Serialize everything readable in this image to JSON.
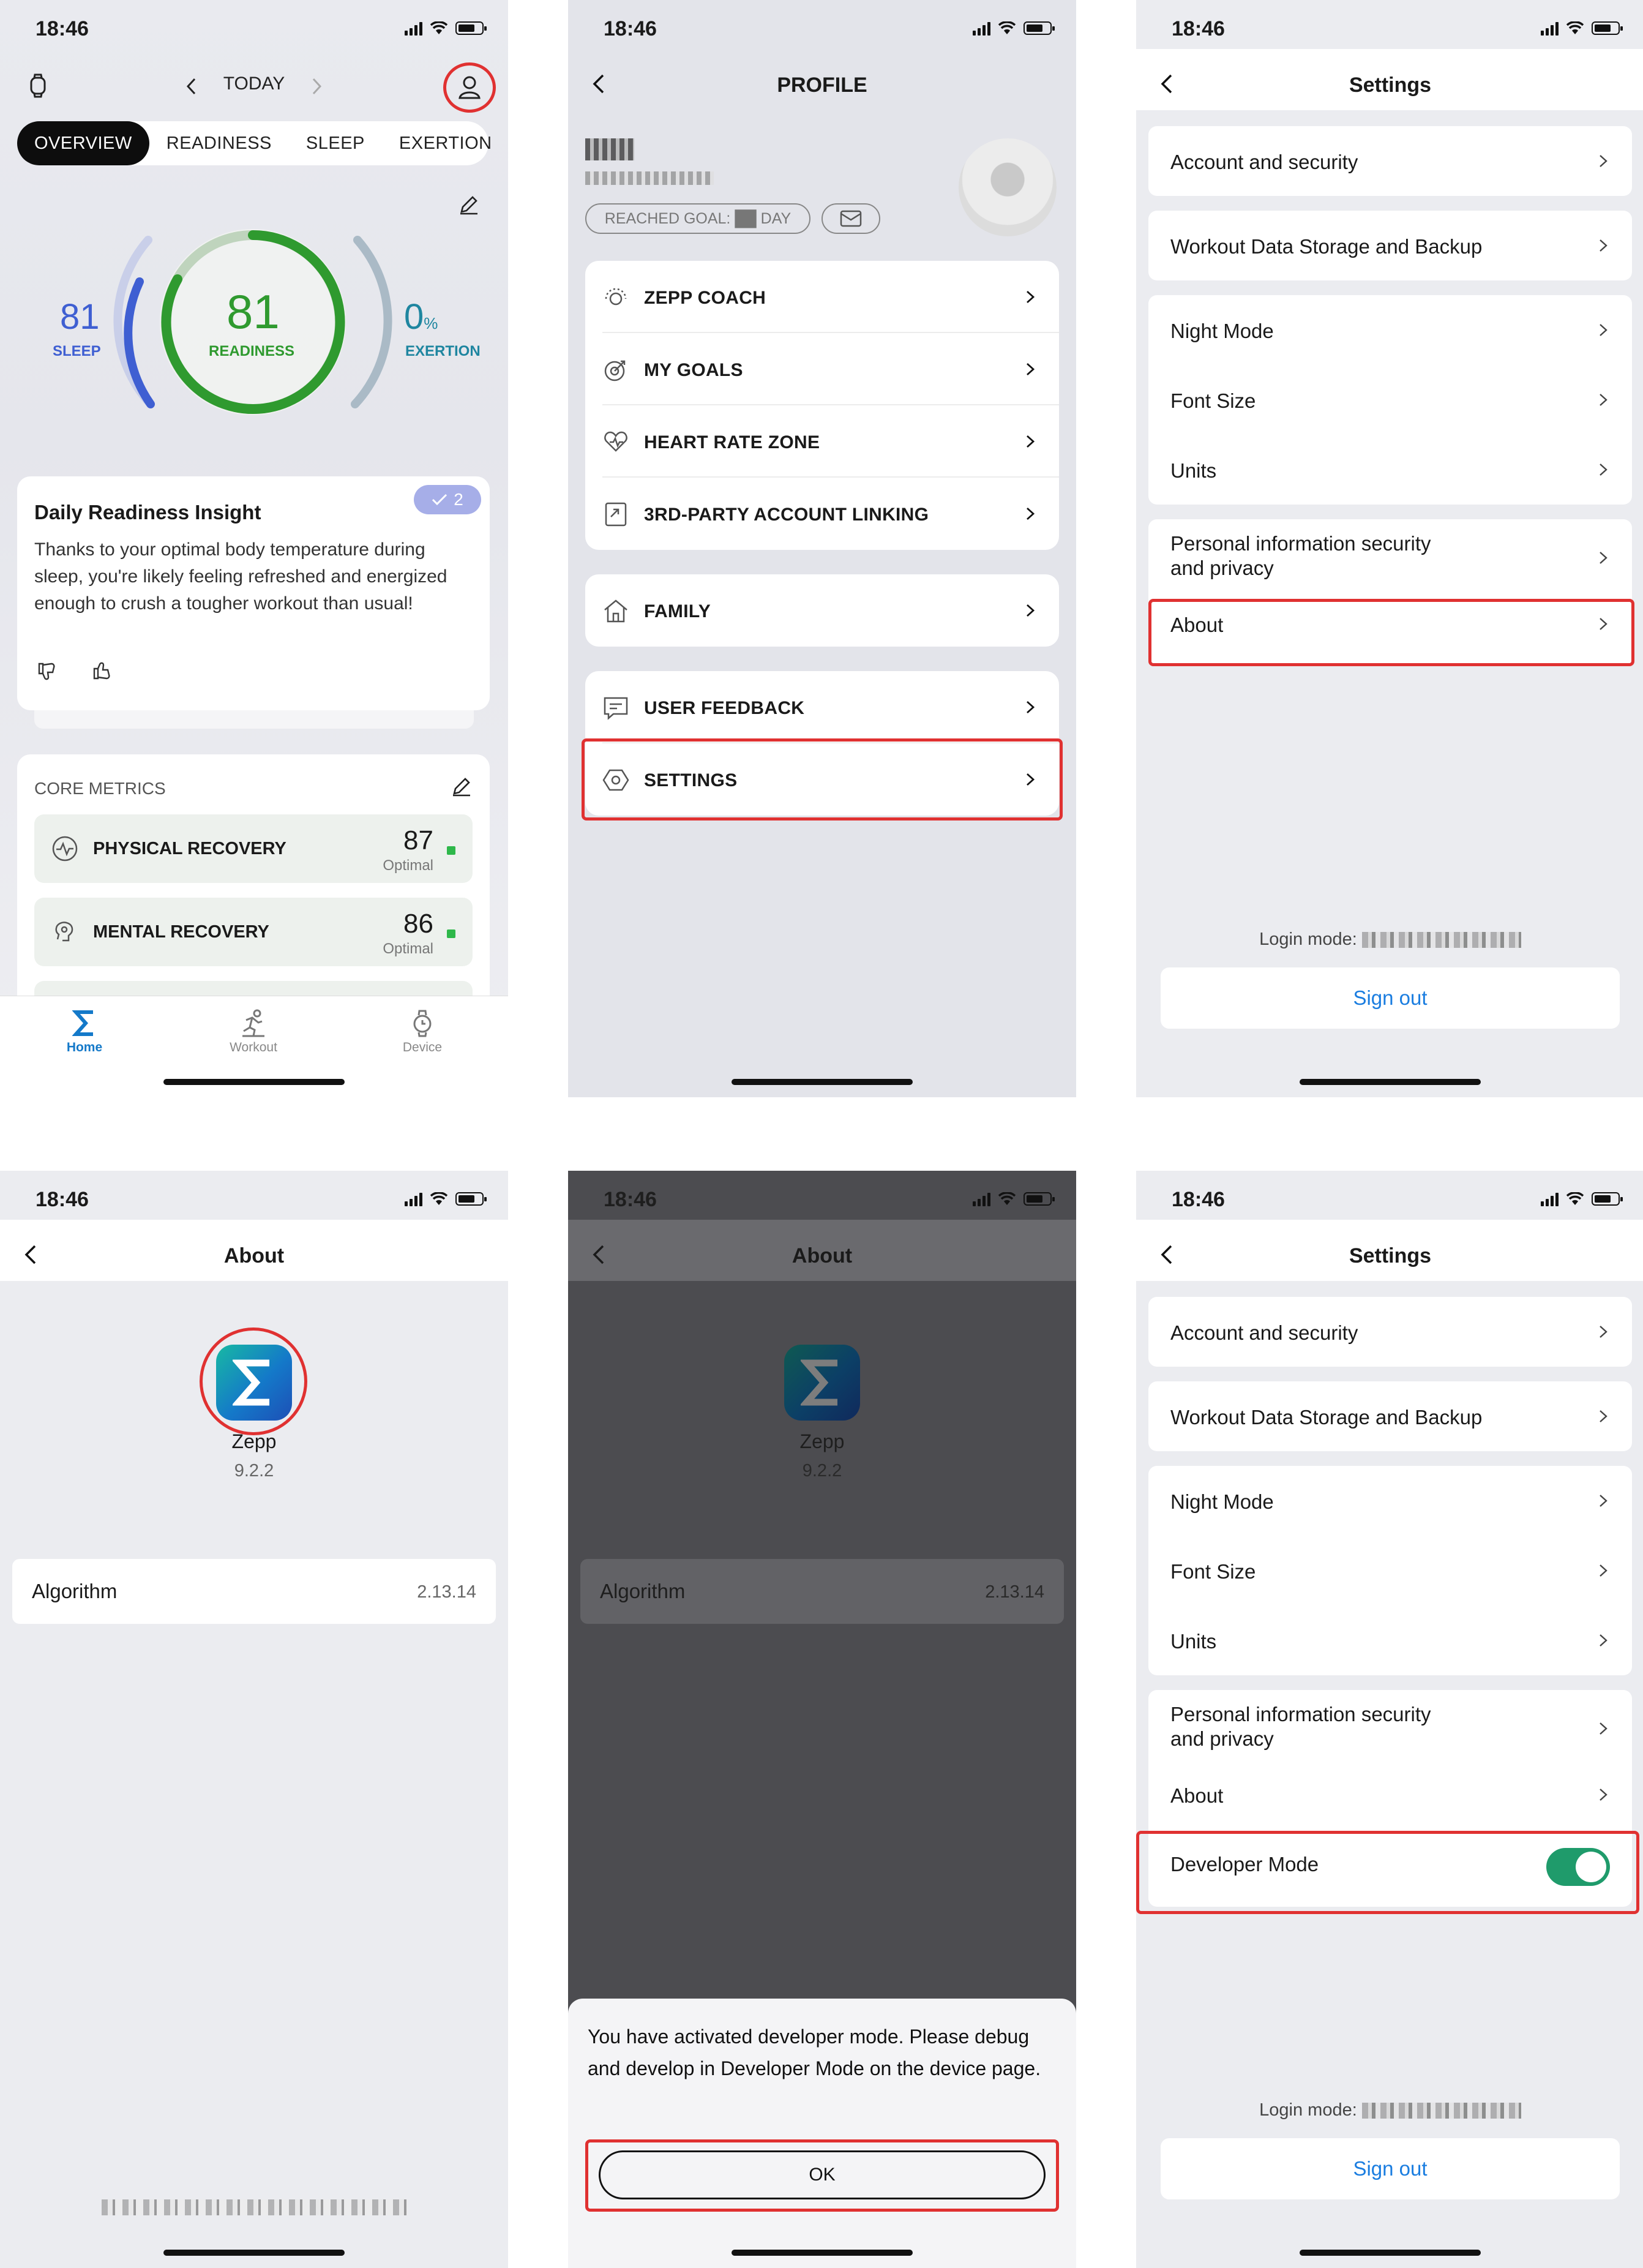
{
  "status": {
    "time": "18:46"
  },
  "home": {
    "date_label": "TODAY",
    "tabs": [
      "OVERVIEW",
      "READINESS",
      "SLEEP",
      "EXERTION"
    ],
    "sleep": {
      "value": "81",
      "label": "SLEEP"
    },
    "readiness": {
      "value": "81",
      "label": "READINESS"
    },
    "exertion": {
      "value": "0",
      "unit": "%",
      "label": "EXERTION"
    },
    "insight": {
      "title": "Daily Readiness Insight",
      "body": "Thanks to your optimal body temperature during sleep, you're likely feeling refreshed and energized enough to crush a tougher workout than usual!",
      "badge_count": "2"
    },
    "core_metrics": {
      "title": "CORE METRICS",
      "items": [
        {
          "label": "PHYSICAL RECOVERY",
          "value": "87",
          "status": "Optimal"
        },
        {
          "label": "MENTAL RECOVERY",
          "value": "86",
          "status": "Optimal"
        }
      ]
    },
    "bottom_tabs": [
      "Home",
      "Workout",
      "Device"
    ],
    "colors": {
      "sleep": "#3f5fd2",
      "readiness": "#2f9a2f",
      "exertion": "#1f86a0",
      "accent": "#1479c9"
    }
  },
  "profile": {
    "title": "PROFILE",
    "goal_pill": "REACHED GOAL: ██ DAY",
    "group1": [
      "ZEPP COACH",
      "MY GOALS",
      "HEART RATE ZONE",
      "3RD-PARTY ACCOUNT LINKING"
    ],
    "group2": [
      "FAMILY"
    ],
    "group3": [
      "USER FEEDBACK",
      "SETTINGS"
    ]
  },
  "settings": {
    "title": "Settings",
    "group1": [
      "Account and security"
    ],
    "group2": [
      "Workout Data Storage and Backup"
    ],
    "group3": [
      "Night Mode",
      "Font Size",
      "Units"
    ],
    "group4": [
      "Personal information security\nand privacy",
      "About"
    ],
    "developer_mode": "Developer Mode",
    "login_mode_label": "Login mode:",
    "sign_out": "Sign out"
  },
  "about": {
    "title": "About",
    "app_name": "Zepp",
    "version": "9.2.2",
    "algorithm_label": "Algorithm",
    "algorithm_version": "2.13.14"
  },
  "dialog": {
    "message": "You have activated developer mode. Please debug and develop in Developer Mode on the device page.",
    "ok": "OK"
  }
}
